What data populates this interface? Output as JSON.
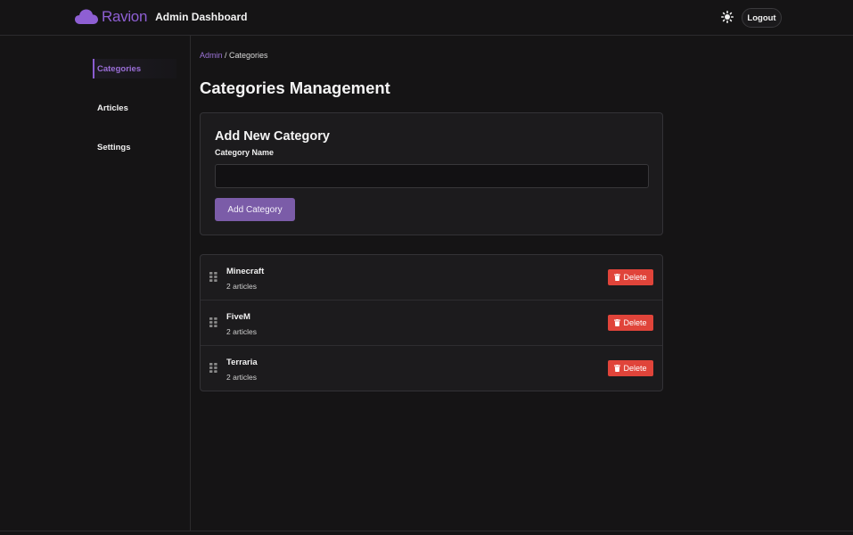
{
  "header": {
    "brand_name": "Ravion",
    "subtitle": "Admin Dashboard",
    "logout_label": "Logout",
    "theme_icon": "sun-icon",
    "brand_icon": "cloud-icon",
    "brand_color": "#8e5fd3"
  },
  "sidebar": {
    "items": [
      {
        "label": "Categories",
        "active": true
      },
      {
        "label": "Articles",
        "active": false
      },
      {
        "label": "Settings",
        "active": false
      }
    ],
    "accent_color": "#9b6fd8"
  },
  "breadcrumb": {
    "root": "Admin",
    "separator": " / ",
    "current": "Categories"
  },
  "page_title": "Categories Management",
  "add_form": {
    "title": "Add New Category",
    "field_label": "Category Name",
    "input_value": "",
    "input_placeholder": "",
    "submit_label": "Add Category"
  },
  "categories": [
    {
      "name": "Minecraft",
      "count": "2 articles",
      "delete_label": "Delete"
    },
    {
      "name": "FiveM",
      "count": "2 articles",
      "delete_label": "Delete"
    },
    {
      "name": "Terraria",
      "count": "2 articles",
      "delete_label": "Delete"
    }
  ],
  "colors": {
    "background": "#151415",
    "card": "#1c1b1d",
    "primary_button": "#7b5ca8",
    "danger": "#e0443a"
  }
}
